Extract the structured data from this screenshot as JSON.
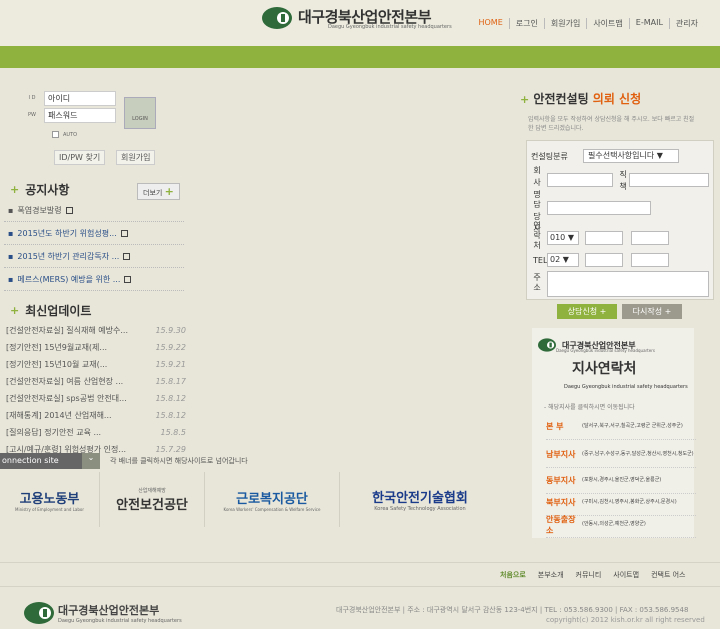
{
  "header": {
    "logo_title": "대구경북산업안전본부",
    "logo_sub": "Daegu Gyeongbuk industrial safety headquarters",
    "nav": [
      "HOME",
      "로그인",
      "회원가입",
      "사이트맵",
      "E-MAIL",
      "관리자"
    ]
  },
  "login": {
    "id_label": "I D",
    "pw_label": "PW",
    "id_value": "아이디",
    "pw_value": "패스워드",
    "login_btn": "LOGIN",
    "auto_label": "AUTO",
    "find_btn": "ID/PW 찾기",
    "join_btn": "회원가입"
  },
  "notice": {
    "title": "공지사항",
    "more": "더보기",
    "items": [
      "폭염경보발령",
      "2015년도 하반기 위험성평...",
      "2015년 하반기 관리감독자 ...",
      "메르스(MERS) 예방을 위한 ..."
    ]
  },
  "updates": {
    "title": "최신업데이트",
    "items": [
      {
        "t": "[건설안전자료실] 질식재해 예방수...",
        "d": "15.9.30"
      },
      {
        "t": "[정기안전] 15년9월교재(제...",
        "d": "15.9.22"
      },
      {
        "t": "[정기안전] 15년10월 교재(...",
        "d": "15.9.21"
      },
      {
        "t": "[건설안전자료실] 여름 산업현장 ...",
        "d": "15.8.17"
      },
      {
        "t": "[건설안전자료실] sps공법 안전대...",
        "d": "15.8.12"
      },
      {
        "t": "[재해통계] 2014년 산업재해...",
        "d": "15.8.12"
      },
      {
        "t": "[질의응답] 정기안전 교육 ...",
        "d": "15.8.5"
      },
      {
        "t": "[고시/예규/훈령] 위험성평가 인정...",
        "d": "15.7.29"
      }
    ]
  },
  "connection": {
    "label": "onnection site",
    "tip": "각 배너를 클릭하시면 해당사이트로 넘어갑니다",
    "banners": [
      "고용노동부",
      "안전보건공단",
      "근로복지공단",
      "한국안전기술협회"
    ],
    "banner_sub": [
      "Ministry of Employment and Labor",
      "산업재해예방",
      "Korea Workers' Compensation & Welfare Service",
      "Korea Safety Technology Association"
    ]
  },
  "consult": {
    "title_a": "안전컨설팅",
    "title_b": "의뢰 신청",
    "desc": "입력사항을 모두 작성하여 상담신청을 해 주시오. 보다 빠르고 친절한 답변 드리겠습니다.",
    "field_type": "컨설팅분류",
    "type_value": "필수선택사항입니다",
    "field_company": "회사명",
    "field_position": "직책",
    "field_manager": "담당자",
    "field_contact": "연락처",
    "contact_prefix": "010",
    "field_tel": "TEL",
    "tel_prefix": "02",
    "field_address": "주소",
    "btn_request": "상담신청",
    "btn_reset": "다시작성"
  },
  "branch": {
    "logo_title": "대구경북산업안전본부",
    "logo_sub": "Daegu Gyeongbuk industrial safety headquarters",
    "title": "지사연락처",
    "sub": "Daegu Gyeongbuk industrial safety headquarters",
    "tip": "- 해당지사를 클릭하시면 이동됩니다",
    "rows": [
      {
        "name": "본 부",
        "desc": "(달서구,북구,서구,칠곡군,고령군 군위군,성주군)"
      },
      {
        "name": "남부지사",
        "desc": "(중구,남구,수성구,동구,달성군,청산시,영천시,청도군)"
      },
      {
        "name": "동부지사",
        "desc": "(포항시,경주시,울진군,영덕군,울릉군)"
      },
      {
        "name": "북부지사",
        "desc": "(구미시,김천시,영주시,봉화군,상주시,문경시)"
      },
      {
        "name": "안동출장소",
        "desc": "(안동시,의성군,예천군,영양군)"
      }
    ]
  },
  "footer": {
    "nav": [
      "처음으로",
      "본부소개",
      "커뮤니티",
      "사이트맵",
      "컨택트 어스"
    ],
    "logo_title": "대구경북산업안전본부",
    "logo_sub": "Daegu Gyeongbuk industrial safety headquarters",
    "info": "대구경북산업안전본부  |  주소 : 대구광역시 달서구 감산동 123-4번지  |  TEL : 053.586.9300  |  FAX : 053.586.9548",
    "copy": "copyright(c) 2012  kish.or.kr all right reserved"
  }
}
